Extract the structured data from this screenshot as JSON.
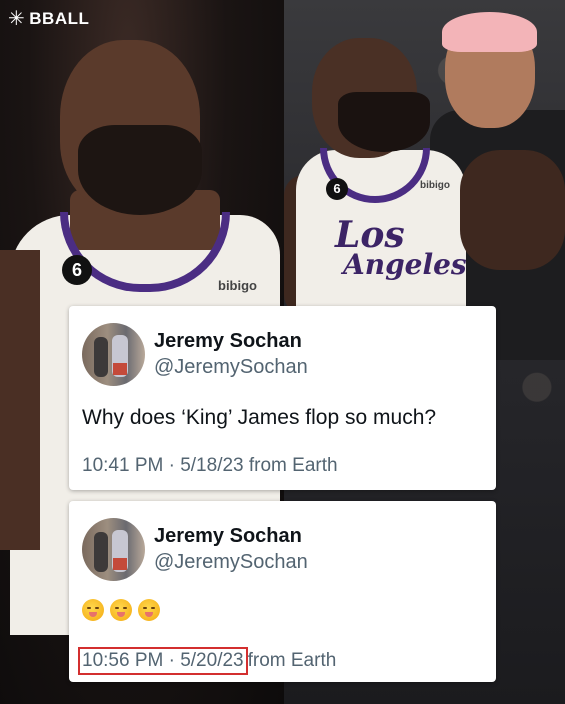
{
  "brand": {
    "name": "BBALL",
    "mark": "✳"
  },
  "photo": {
    "left_jersey_number": "6",
    "left_sponsor": "bibigo",
    "right_jersey_number": "6",
    "right_sponsor": "bibigo",
    "right_jersey_line1": "Los",
    "right_jersey_line2": "Angeles"
  },
  "tweets": [
    {
      "name": "Jeremy Sochan",
      "handle": "@JeremySochan",
      "text": "Why does ‘King’ James flop so much?",
      "time": "10:41 PM · 5/18/23 from Earth"
    },
    {
      "name": "Jeremy Sochan",
      "handle": "@JeremySochan",
      "emojis": "🫢🫢🫢",
      "time_highlighted": "10:56 PM · 5/20/23",
      "time_suffix": "from Earth"
    }
  ],
  "colors": {
    "highlight": "#d32f2f",
    "lakers_purple": "#4b2d83"
  }
}
